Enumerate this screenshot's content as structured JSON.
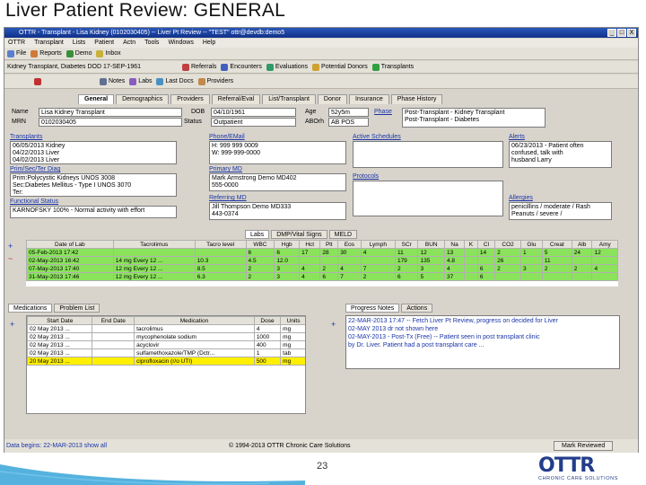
{
  "slide": {
    "title": "Liver Patient Review:  GENERAL",
    "page_number": "23"
  },
  "window": {
    "title": "OTTR - Transplant - Lisa Kidney (0102030405) -- Liver Pt Review -- \"TEST\" ottr@devdb:demo5",
    "buttons": [
      "_",
      "□",
      "X"
    ]
  },
  "menu": [
    "OTTR",
    "Transplant",
    "Lists",
    "Patient",
    "Actn",
    "Tools",
    "Windows",
    "Help"
  ],
  "toolbar1": [
    "File",
    "Reports",
    "Demo",
    "Inbox"
  ],
  "toolbar2": {
    "context": "Kidney Transplant, Diabetes  DOD  17-SEP-1961",
    "buttons": [
      "Referrals",
      "Encounters",
      "Evaluations",
      "Potential Donors",
      "Transplants"
    ]
  },
  "toolbar3": [
    "Notes",
    "Labs",
    "Last Docs",
    "Providers"
  ],
  "tabs": [
    "General",
    "Demographics",
    "Providers",
    "Referral/Eval",
    "List/Transplant",
    "Donor",
    "Insurance",
    "Phase History"
  ],
  "patient": {
    "name_label": "Name",
    "name": "Lisa Kidney Transplant",
    "mrn_label": "MRN",
    "mrn": "0102030405",
    "dob_label": "DOB",
    "dob": "04/10/1961",
    "status_label": "Status",
    "status": "Outpatient",
    "age_label": "Age",
    "age": "52y5m",
    "abo_label": "ABOrh",
    "abo": "AB POS",
    "phase_label": "Phase",
    "phase": [
      "Post-Transplant - Kidney Transplant",
      "Post-Transplant - Diabetes"
    ]
  },
  "sections": {
    "transplants": {
      "title": "Transplants",
      "lines": [
        "06/05/2013 Kidney",
        "04/22/2013 Liver",
        "04/02/2013 Liver"
      ]
    },
    "phone_email": {
      "title": "Phone/EMail",
      "lines": [
        "H: 999 999 0009",
        "W: 999-999-0000"
      ]
    },
    "active_schedules": {
      "title": "Active Schedules"
    },
    "alerts": {
      "title": "Alerts",
      "lines": [
        "06/23/2013 - Patient often",
        "confused, talk with",
        "husband Larry"
      ]
    },
    "prim_diag": {
      "title": "Prim/Sec/Ter Diag",
      "lines": [
        "Prim:Polycystic Kidneys UNOS 3008",
        "Sec:Diabetes Mellitus - Type I UNOS 3070",
        "Ter:"
      ]
    },
    "primary_md": {
      "title": "Primary MD",
      "lines": [
        "Mark Armstrong Demo MD402",
        "555-0000"
      ]
    },
    "protocols": {
      "title": "Protocols"
    },
    "functional_status": {
      "title": "Functional Status",
      "lines": [
        "KARNOFSKY 100% - Normal activity with effort"
      ]
    },
    "referring_md": {
      "title": "Referring MD",
      "lines": [
        "Jill Thompson Demo MD333",
        "443-0374"
      ]
    },
    "allergies": {
      "title": "Allergies",
      "lines": [
        "penicillins / moderate / Rash",
        "Peanuts / severe /"
      ]
    }
  },
  "lab_tabs": [
    "Labs",
    "DMP/Vital Signs",
    "MELD"
  ],
  "labs": {
    "headers": [
      "Date of Lab",
      "Tacrolimus",
      "Tacro level",
      "WBC",
      "Hgb",
      "Hct",
      "Plt",
      "Eos",
      "Lymph",
      "SCr",
      "BUN",
      "Na",
      "K",
      "Cl",
      "CO2",
      "Glu",
      "Creat",
      "Alb",
      "Amy"
    ],
    "rows": [
      [
        "05-Feb-2013 17:42",
        "",
        "",
        "6",
        "6",
        "17",
        "28",
        "30",
        "4",
        "11",
        "12",
        "13",
        "",
        "14",
        "2",
        "1",
        "5",
        "24",
        "12"
      ],
      [
        "02-May-2013 16:42",
        "14 mg Every 12 ...",
        "10.3",
        "4.5",
        "12.0",
        "",
        "",
        "",
        "",
        "179",
        "135",
        "4.8",
        "",
        "",
        "26",
        "",
        "11",
        "",
        ""
      ],
      [
        "07-May-2013 17:40",
        "12 mg Every 12 ...",
        "8.5",
        "2",
        "3",
        "4",
        "2",
        "4",
        "7",
        "2",
        "3",
        "4",
        "",
        "6",
        "2",
        "3",
        "2",
        "2",
        "4"
      ],
      [
        "31-May-2013 17:46",
        "12 mg Every 12 ...",
        "6.3",
        "2",
        "3",
        "4",
        "6",
        "7",
        "2",
        "6",
        "5",
        "37",
        "",
        "6",
        "",
        "",
        "",
        "",
        ""
      ]
    ]
  },
  "med_tabs": [
    "Medications",
    "Problem List"
  ],
  "meds": {
    "headers": [
      "Start Date",
      "End Date",
      "Medication",
      "Dose",
      "Units"
    ],
    "rows": [
      [
        "02 May 2013 ...",
        "",
        "tacrolimus",
        "4",
        "mg"
      ],
      [
        "02 May 2013 ...",
        "",
        "mycophenolate sodium",
        "1000",
        "mg"
      ],
      [
        "02 May 2013 ...",
        "",
        "acyclovir",
        "400",
        "mg"
      ],
      [
        "02 May 2013 ...",
        "",
        "sulfamethoxazole/TMP (Dctr...",
        "1",
        "tab"
      ],
      [
        "20 May 2013 ...",
        "",
        "ciprofloxacin (r/o UTI)",
        "500",
        "mg"
      ]
    ]
  },
  "notes_tabs": [
    "Progress Notes",
    "Actions"
  ],
  "notes": [
    "22-MAR-2013 17:47 -- Fetch Liver Pt Review, progress on decided for Liver",
    "02-MAY 2013 dr not shown here",
    "02-MAY-2013 - Post-Tx (Free)   -- Patient seen in post transplant clinic",
    "by Dr. Liver. Patient had a post transplant care ..."
  ],
  "footer": {
    "left": "Data begins:  22-MAR-2013 show all",
    "center": "© 1994-2013 OTTR Chronic Care Solutions",
    "right": "Mark Reviewed"
  },
  "logo": {
    "name": "OTTR",
    "tagline": "CHRONIC CARE SOLUTIONS",
    "color": "#233d8a"
  },
  "colors": {
    "lab_green": "#8be35c",
    "highlight_yellow": "#ffef00",
    "link_blue": "#1a35a8"
  }
}
